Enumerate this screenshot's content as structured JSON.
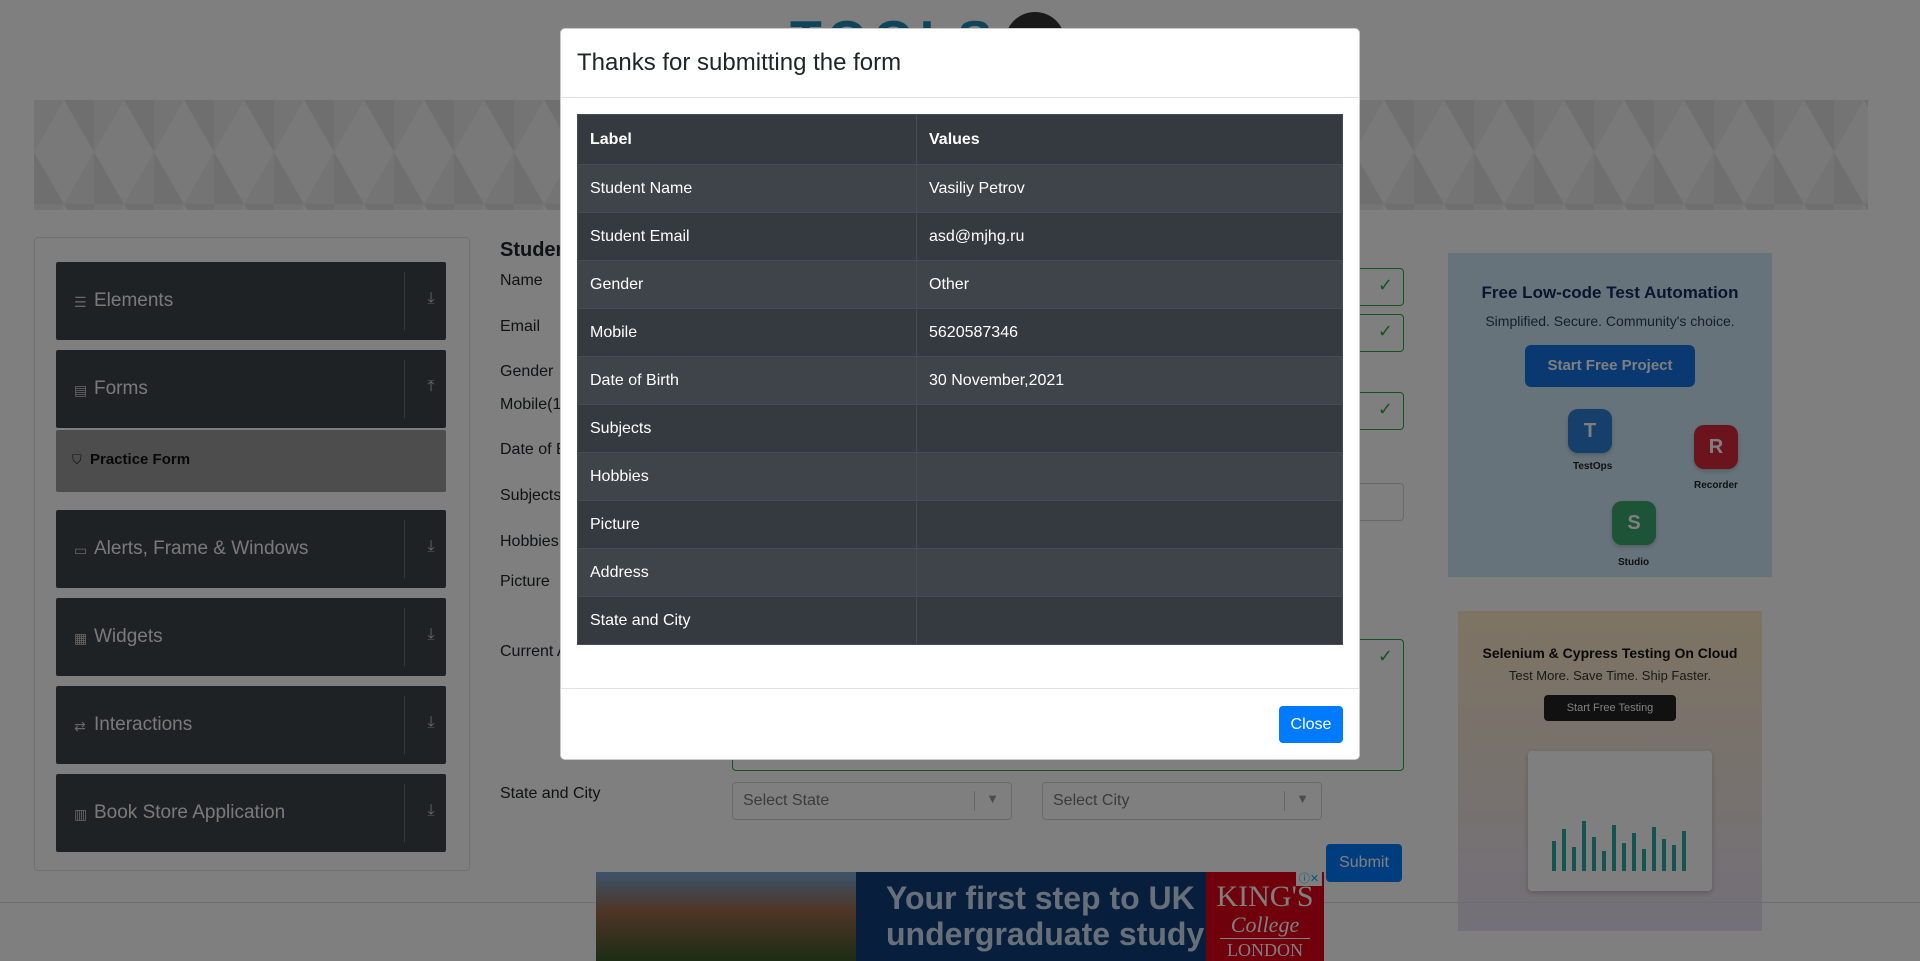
{
  "modal": {
    "title": "Thanks for submitting the form",
    "close_label": "Close",
    "table": {
      "headers": [
        "Label",
        "Values"
      ],
      "rows": [
        [
          "Student Name",
          "Vasiliy Petrov"
        ],
        [
          "Student Email",
          "asd@mjhg.ru"
        ],
        [
          "Gender",
          "Other"
        ],
        [
          "Mobile",
          "5620587346"
        ],
        [
          "Date of Birth",
          "30 November,2021"
        ],
        [
          "Subjects",
          ""
        ],
        [
          "Hobbies",
          ""
        ],
        [
          "Picture",
          ""
        ],
        [
          "Address",
          ""
        ],
        [
          "State and City",
          ""
        ]
      ]
    }
  },
  "sidebar": {
    "groups": [
      {
        "label": "Elements",
        "icon": "list-icon"
      },
      {
        "label": "Forms",
        "icon": "file-icon"
      },
      {
        "label": "Alerts, Frame & Windows",
        "icon": "window-icon"
      },
      {
        "label": "Widgets",
        "icon": "grid-icon"
      },
      {
        "label": "Interactions",
        "icon": "interaction-icon"
      },
      {
        "label": "Book Store Application",
        "icon": "books-icon"
      }
    ],
    "active_item": "Practice Form"
  },
  "form": {
    "title": "Studen",
    "labels": {
      "name": "Name",
      "email": "Email",
      "gender": "Gender",
      "mobile": "Mobile(1",
      "dob": "Date of B",
      "subjects": "Subjects",
      "hobbies": "Hobbies",
      "picture": "Picture",
      "address": "Current A",
      "state_city": "State and City"
    },
    "state_placeholder": "Select State",
    "city_placeholder": "Select City",
    "submit_label": "Submit"
  },
  "ads": {
    "katalon": {
      "title": "Free Low-code Test Automation",
      "subtitle": "Simplified. Secure. Community's choice.",
      "button": "Start Free Project",
      "labels": [
        "TestOps",
        "Recorder",
        "Studio"
      ]
    },
    "lambdatest": {
      "title": "Selenium & Cypress Testing On Cloud",
      "subtitle": "Test More. Save Time. Ship Faster.",
      "button": "Start Free Testing"
    },
    "bottom": {
      "text_line1": "Your first step to UK",
      "text_line2": "undergraduate study",
      "brand_line1": "KING'S",
      "brand_line2": "College",
      "brand_line3": "LONDON"
    }
  },
  "colors": {
    "primary": "#007bff",
    "table_dark": "#343a40",
    "sidebar_dark": "#3f454b",
    "valid_green": "#28a745"
  }
}
